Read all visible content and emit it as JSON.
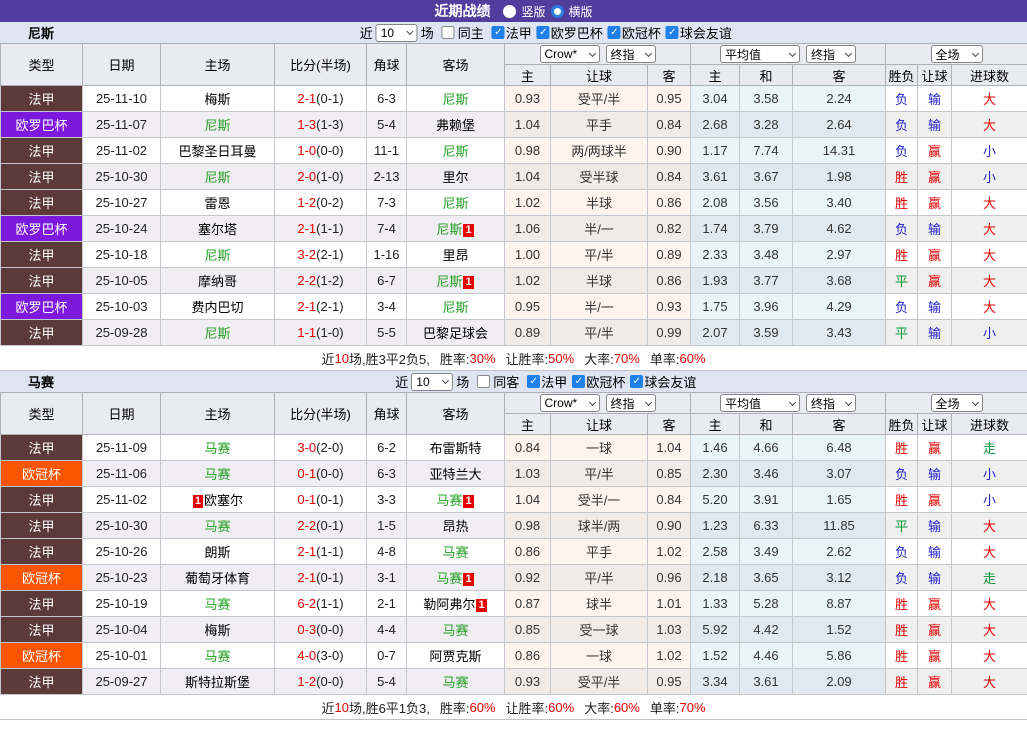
{
  "title_bar": {
    "title": "近期战绩",
    "vertical_label": "竖版",
    "horizontal_label": "横版"
  },
  "colors": {
    "titlebar_bg": "#503D9E",
    "section_bar_bg": "#DEE4F2",
    "accent_blue": "#1E80E8",
    "green_team": "#22A022",
    "score_red": "#E60000",
    "league_colors": {
      "法甲": "#5D3A3A",
      "欧罗巴杯": "#7D19DE",
      "欧冠杯": "#FB5502"
    },
    "result_colors": {
      "胜": "#E60000",
      "赢": "#E60000",
      "大": "#E60000",
      "平": "#009933",
      "走": "#009933",
      "负": "#2222CC",
      "输": "#2222CC",
      "小": "#2222CC"
    }
  },
  "sections": [
    {
      "team": "尼斯",
      "filter": {
        "recent_label": "近",
        "recent_value": "10",
        "games_label": "场",
        "same": {
          "label": "同主",
          "checked": false
        },
        "leagues": [
          {
            "label": "法甲",
            "checked": true
          },
          {
            "label": "欧罗巴杯",
            "checked": true
          },
          {
            "label": "欧冠杯",
            "checked": true
          },
          {
            "label": "球会友谊",
            "checked": true
          }
        ]
      },
      "dropdowns": {
        "company": "Crow*",
        "company_time": "终指",
        "average": "平均值",
        "average_time": "终指",
        "scope": "全场"
      },
      "headers": {
        "left": [
          "类型",
          "日期",
          "主场",
          "比分(半场)",
          "角球",
          "客场"
        ],
        "odds": [
          "主",
          "让球",
          "客"
        ],
        "avg": [
          "主",
          "和",
          "客"
        ],
        "result": [
          "胜负",
          "让球",
          "进球数"
        ]
      },
      "rows": [
        {
          "league": "法甲",
          "date": "25-11-10",
          "home": {
            "name": "梅斯"
          },
          "score": "2-1",
          "half": "(0-1)",
          "corner": "6-3",
          "away": {
            "name": "尼斯",
            "green": true
          },
          "odds": [
            "0.93",
            "受平/半",
            "0.95"
          ],
          "avg": [
            "3.04",
            "3.58",
            "2.24"
          ],
          "result": [
            "负",
            "输",
            "大"
          ]
        },
        {
          "league": "欧罗巴杯",
          "date": "25-11-07",
          "home": {
            "name": "尼斯",
            "green": true
          },
          "score": "1-3",
          "half": "(1-3)",
          "corner": "5-4",
          "away": {
            "name": "弗赖堡"
          },
          "odds": [
            "1.04",
            "平手",
            "0.84"
          ],
          "avg": [
            "2.68",
            "3.28",
            "2.64"
          ],
          "result": [
            "负",
            "输",
            "大"
          ]
        },
        {
          "league": "法甲",
          "date": "25-11-02",
          "home": {
            "name": "巴黎圣日耳曼"
          },
          "score": "1-0",
          "half": "(0-0)",
          "corner": "11-1",
          "away": {
            "name": "尼斯",
            "green": true
          },
          "odds": [
            "0.98",
            "两/两球半",
            "0.90"
          ],
          "avg": [
            "1.17",
            "7.74",
            "14.31"
          ],
          "result": [
            "负",
            "赢",
            "小"
          ]
        },
        {
          "league": "法甲",
          "date": "25-10-30",
          "home": {
            "name": "尼斯",
            "green": true
          },
          "score": "2-0",
          "half": "(1-0)",
          "corner": "2-13",
          "away": {
            "name": "里尔"
          },
          "odds": [
            "1.04",
            "受半球",
            "0.84"
          ],
          "avg": [
            "3.61",
            "3.67",
            "1.98"
          ],
          "result": [
            "胜",
            "赢",
            "小"
          ]
        },
        {
          "league": "法甲",
          "date": "25-10-27",
          "home": {
            "name": "雷恩"
          },
          "score": "1-2",
          "half": "(0-2)",
          "corner": "7-3",
          "away": {
            "name": "尼斯",
            "green": true
          },
          "odds": [
            "1.02",
            "半球",
            "0.86"
          ],
          "avg": [
            "2.08",
            "3.56",
            "3.40"
          ],
          "result": [
            "胜",
            "赢",
            "大"
          ]
        },
        {
          "league": "欧罗巴杯",
          "date": "25-10-24",
          "home": {
            "name": "塞尔塔"
          },
          "score": "2-1",
          "half": "(1-1)",
          "corner": "7-4",
          "away": {
            "name": "尼斯",
            "green": true,
            "badge": true
          },
          "odds": [
            "1.06",
            "半/一",
            "0.82"
          ],
          "avg": [
            "1.74",
            "3.79",
            "4.62"
          ],
          "result": [
            "负",
            "输",
            "大"
          ]
        },
        {
          "league": "法甲",
          "date": "25-10-18",
          "home": {
            "name": "尼斯",
            "green": true
          },
          "score": "3-2",
          "half": "(2-1)",
          "corner": "1-16",
          "away": {
            "name": "里昂"
          },
          "odds": [
            "1.00",
            "平/半",
            "0.89"
          ],
          "avg": [
            "2.33",
            "3.48",
            "2.97"
          ],
          "result": [
            "胜",
            "赢",
            "大"
          ]
        },
        {
          "league": "法甲",
          "date": "25-10-05",
          "home": {
            "name": "摩纳哥"
          },
          "score": "2-2",
          "half": "(1-2)",
          "corner": "6-7",
          "away": {
            "name": "尼斯",
            "green": true,
            "badge": true
          },
          "odds": [
            "1.02",
            "半球",
            "0.86"
          ],
          "avg": [
            "1.93",
            "3.77",
            "3.68"
          ],
          "result": [
            "平",
            "赢",
            "大"
          ]
        },
        {
          "league": "欧罗巴杯",
          "date": "25-10-03",
          "home": {
            "name": "费内巴切"
          },
          "score": "2-1",
          "half": "(2-1)",
          "corner": "3-4",
          "away": {
            "name": "尼斯",
            "green": true
          },
          "odds": [
            "0.95",
            "半/一",
            "0.93"
          ],
          "avg": [
            "1.75",
            "3.96",
            "4.29"
          ],
          "result": [
            "负",
            "输",
            "大"
          ]
        },
        {
          "league": "法甲",
          "date": "25-09-28",
          "home": {
            "name": "尼斯",
            "green": true
          },
          "score": "1-1",
          "half": "(1-0)",
          "corner": "5-5",
          "away": {
            "name": "巴黎足球会"
          },
          "odds": [
            "0.89",
            "平/半",
            "0.99"
          ],
          "avg": [
            "2.07",
            "3.59",
            "3.43"
          ],
          "result": [
            "平",
            "输",
            "小"
          ]
        }
      ],
      "summary": {
        "lead": [
          [
            "近",
            false
          ],
          [
            "10",
            true
          ],
          [
            "场,胜3平2负5, ",
            false
          ]
        ],
        "stats": [
          [
            "胜率:",
            "30%"
          ],
          [
            "让胜率:",
            "50%"
          ],
          [
            "大率:",
            "70%"
          ],
          [
            "单率:",
            "60%"
          ]
        ]
      }
    },
    {
      "team": "马赛",
      "filter": {
        "recent_label": "近",
        "recent_value": "10",
        "games_label": "场",
        "same": {
          "label": "同客",
          "checked": false
        },
        "leagues": [
          {
            "label": "法甲",
            "checked": true
          },
          {
            "label": "欧冠杯",
            "checked": true
          },
          {
            "label": "球会友谊",
            "checked": true
          }
        ]
      },
      "dropdowns": {
        "company": "Crow*",
        "company_time": "终指",
        "average": "平均值",
        "average_time": "终指",
        "scope": "全场"
      },
      "headers": {
        "left": [
          "类型",
          "日期",
          "主场",
          "比分(半场)",
          "角球",
          "客场"
        ],
        "odds": [
          "主",
          "让球",
          "客"
        ],
        "avg": [
          "主",
          "和",
          "客"
        ],
        "result": [
          "胜负",
          "让球",
          "进球数"
        ]
      },
      "rows": [
        {
          "league": "法甲",
          "date": "25-11-09",
          "home": {
            "name": "马赛",
            "green": true
          },
          "score": "3-0",
          "half": "(2-0)",
          "corner": "6-2",
          "away": {
            "name": "布雷斯特"
          },
          "odds": [
            "0.84",
            "一球",
            "1.04"
          ],
          "avg": [
            "1.46",
            "4.66",
            "6.48"
          ],
          "result": [
            "胜",
            "赢",
            "走"
          ]
        },
        {
          "league": "欧冠杯",
          "date": "25-11-06",
          "home": {
            "name": "马赛",
            "green": true
          },
          "score": "0-1",
          "half": "(0-0)",
          "corner": "6-3",
          "away": {
            "name": "亚特兰大"
          },
          "odds": [
            "1.03",
            "平/半",
            "0.85"
          ],
          "avg": [
            "2.30",
            "3.46",
            "3.07"
          ],
          "result": [
            "负",
            "输",
            "小"
          ]
        },
        {
          "league": "法甲",
          "date": "25-11-02",
          "home": {
            "name": "欧塞尔",
            "badge_pre": true
          },
          "score": "0-1",
          "half": "(0-1)",
          "corner": "3-3",
          "away": {
            "name": "马赛",
            "green": true,
            "badge": true
          },
          "odds": [
            "1.04",
            "受半/一",
            "0.84"
          ],
          "avg": [
            "5.20",
            "3.91",
            "1.65"
          ],
          "result": [
            "胜",
            "赢",
            "小"
          ]
        },
        {
          "league": "法甲",
          "date": "25-10-30",
          "home": {
            "name": "马赛",
            "green": true
          },
          "score": "2-2",
          "half": "(0-1)",
          "corner": "1-5",
          "away": {
            "name": "昂热"
          },
          "odds": [
            "0.98",
            "球半/两",
            "0.90"
          ],
          "avg": [
            "1.23",
            "6.33",
            "11.85"
          ],
          "result": [
            "平",
            "输",
            "大"
          ]
        },
        {
          "league": "法甲",
          "date": "25-10-26",
          "home": {
            "name": "朗斯"
          },
          "score": "2-1",
          "half": "(1-1)",
          "corner": "4-8",
          "away": {
            "name": "马赛",
            "green": true
          },
          "odds": [
            "0.86",
            "平手",
            "1.02"
          ],
          "avg": [
            "2.58",
            "3.49",
            "2.62"
          ],
          "result": [
            "负",
            "输",
            "大"
          ]
        },
        {
          "league": "欧冠杯",
          "date": "25-10-23",
          "home": {
            "name": "葡萄牙体育"
          },
          "score": "2-1",
          "half": "(0-1)",
          "corner": "3-1",
          "away": {
            "name": "马赛",
            "green": true,
            "badge": true
          },
          "odds": [
            "0.92",
            "平/半",
            "0.96"
          ],
          "avg": [
            "2.18",
            "3.65",
            "3.12"
          ],
          "result": [
            "负",
            "输",
            "走"
          ]
        },
        {
          "league": "法甲",
          "date": "25-10-19",
          "home": {
            "name": "马赛",
            "green": true
          },
          "score": "6-2",
          "half": "(1-1)",
          "corner": "2-1",
          "away": {
            "name": "勒阿弗尔",
            "badge": true
          },
          "odds": [
            "0.87",
            "球半",
            "1.01"
          ],
          "avg": [
            "1.33",
            "5.28",
            "8.87"
          ],
          "result": [
            "胜",
            "赢",
            "大"
          ]
        },
        {
          "league": "法甲",
          "date": "25-10-04",
          "home": {
            "name": "梅斯"
          },
          "score": "0-3",
          "half": "(0-0)",
          "corner": "4-4",
          "away": {
            "name": "马赛",
            "green": true
          },
          "odds": [
            "0.85",
            "受一球",
            "1.03"
          ],
          "avg": [
            "5.92",
            "4.42",
            "1.52"
          ],
          "result": [
            "胜",
            "赢",
            "大"
          ]
        },
        {
          "league": "欧冠杯",
          "date": "25-10-01",
          "home": {
            "name": "马赛",
            "green": true
          },
          "score": "4-0",
          "half": "(3-0)",
          "corner": "0-7",
          "away": {
            "name": "阿贾克斯"
          },
          "odds": [
            "0.86",
            "一球",
            "1.02"
          ],
          "avg": [
            "1.52",
            "4.46",
            "5.86"
          ],
          "result": [
            "胜",
            "赢",
            "大"
          ]
        },
        {
          "league": "法甲",
          "date": "25-09-27",
          "home": {
            "name": "斯特拉斯堡"
          },
          "score": "1-2",
          "half": "(0-0)",
          "corner": "5-4",
          "away": {
            "name": "马赛",
            "green": true
          },
          "odds": [
            "0.93",
            "受平/半",
            "0.95"
          ],
          "avg": [
            "3.34",
            "3.61",
            "2.09"
          ],
          "result": [
            "胜",
            "赢",
            "大"
          ]
        }
      ],
      "summary": {
        "lead": [
          [
            "近",
            false
          ],
          [
            "10",
            true
          ],
          [
            "场,胜6平1负3, ",
            false
          ]
        ],
        "stats": [
          [
            "胜率:",
            "60%"
          ],
          [
            "让胜率:",
            "60%"
          ],
          [
            "大率:",
            "60%"
          ],
          [
            "单率:",
            "70%"
          ]
        ]
      }
    }
  ]
}
